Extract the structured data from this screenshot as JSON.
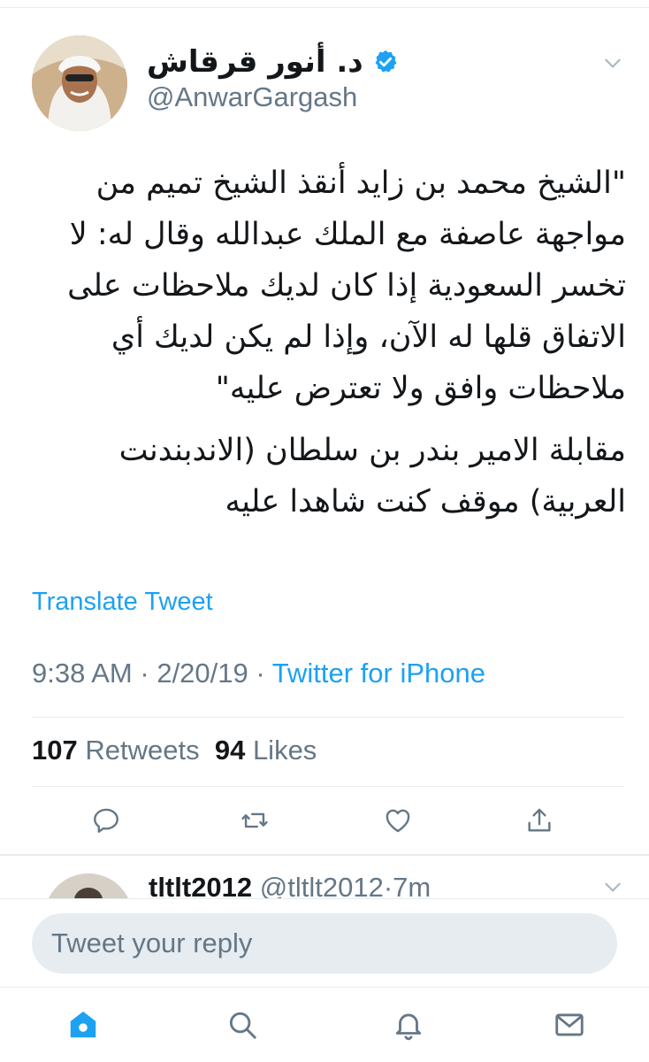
{
  "author": {
    "display_name": "د. أنور قرقاش",
    "handle": "@AnwarGargash",
    "verified": true
  },
  "tweet": {
    "paragraph_1": "\"الشيخ محمد بن زايد أنقذ الشيخ تميم من مواجهة عاصفة مع الملك عبدالله وقال له: لا تخسر السعودية إذا كان لديك ملاحظات على الاتفاق قلها له الآن، وإذا لم يكن لديك أي ملاحظات وافق ولا تعترض عليه\"",
    "paragraph_2": "مقابلة الامير بندر بن سلطان (الاندبندنت العربية) موقف كنت شاهدا عليه",
    "translate_label": "Translate Tweet",
    "time": "9:38 AM",
    "date": "2/20/19",
    "separator": "·",
    "source": "Twitter for iPhone"
  },
  "stats": {
    "retweets_count": "107",
    "retweets_label": "Retweets",
    "likes_count": "94",
    "likes_label": "Likes"
  },
  "actions": [
    "reply-icon",
    "retweet-icon",
    "like-icon",
    "share-icon"
  ],
  "reply": {
    "display_name": "tltlt2012",
    "handle": "@tltlt2012",
    "separator": "·",
    "age": "7m"
  },
  "compose": {
    "placeholder": "Tweet your reply"
  },
  "tabbar": {
    "items": [
      "home-icon",
      "search-icon",
      "notifications-icon",
      "messages-icon"
    ],
    "active": "home-icon"
  },
  "colors": {
    "accent": "#1da1f2",
    "secondary_text": "#657786",
    "primary_text": "#14171a",
    "divider": "#e6ecf0"
  }
}
